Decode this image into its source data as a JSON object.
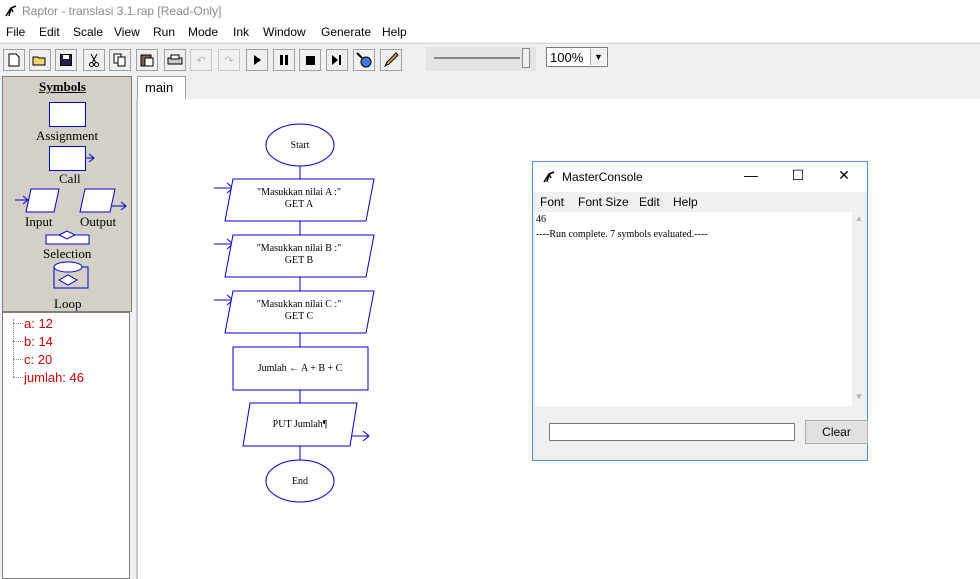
{
  "window": {
    "title": "Raptor - translasi 3.1.rap [Read-Only]"
  },
  "menu": [
    "File",
    "Edit",
    "Scale",
    "View",
    "Run",
    "Mode",
    "Ink",
    "Window",
    "Generate",
    "Help"
  ],
  "toolbar": {
    "zoom_value": "100%",
    "icons": [
      "new-icon",
      "open-icon",
      "save-icon",
      "cut-icon",
      "copy-icon",
      "paste-icon",
      "print-icon",
      "undo-icon",
      "redo-icon",
      "run-icon",
      "pause-icon",
      "stop-icon",
      "step-icon",
      "watch-icon",
      "pen-icon"
    ]
  },
  "symbols": {
    "header": "Symbols",
    "assignment": "Assignment",
    "call": "Call",
    "input": "Input",
    "output": "Output",
    "selection": "Selection",
    "loop": "Loop"
  },
  "variables": [
    "a: 12",
    "b: 14",
    "c: 20",
    "jumlah: 46"
  ],
  "tabs": [
    "main"
  ],
  "flowchart": {
    "start": "Start",
    "input1_line1": "\"Masukkan nilai A :\"",
    "input1_line2": "GET A",
    "input2_line1": "\"Masukkan nilai B :\"",
    "input2_line2": "GET B",
    "input3_line1": "\"Masukkan nilai C :\"",
    "input3_line2": "GET C",
    "assignment": "Jumlah ← A + B + C",
    "output": "PUT Jumlah¶",
    "end": "End"
  },
  "console": {
    "title": "MasterConsole",
    "menu": [
      "Font",
      "Font Size",
      "Edit",
      "Help"
    ],
    "output_line1": "46",
    "output_line2": "----Run complete.  7 symbols evaluated.----",
    "clear_label": "Clear",
    "minimize": "—",
    "maximize": "☐",
    "close": "✕"
  },
  "colors": {
    "flow_blue": "#0000cc",
    "variable_red": "#d00000"
  }
}
